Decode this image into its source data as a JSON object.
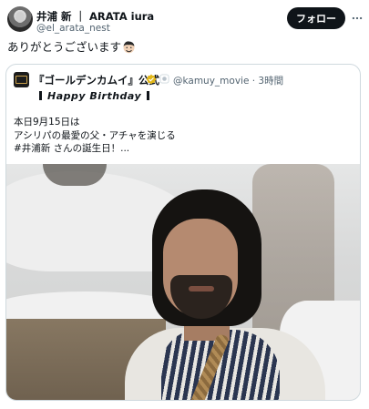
{
  "tweet": {
    "author": {
      "display_name": "井浦 新 ｜ ARATA iura",
      "handle": "@el_arata_nest"
    },
    "follow_label": "フォロー",
    "text": "ありがとうございます"
  },
  "quote": {
    "author": {
      "display_name": "『ゴールデンカムイ』公式",
      "handle": "@kamuy_movie",
      "time": "3時間",
      "meta": "@kamuy_movie · 3時間"
    },
    "birthday_text": "Happy Birthday",
    "body_lines": [
      "本日9月15日は",
      "アシリパの最愛の父・アチャを演じる",
      "#井浦新 さんの誕生日！..."
    ]
  },
  "colors": {
    "accent": "#0f1419",
    "secondary_text": "#536471",
    "border": "#cfd9de"
  }
}
